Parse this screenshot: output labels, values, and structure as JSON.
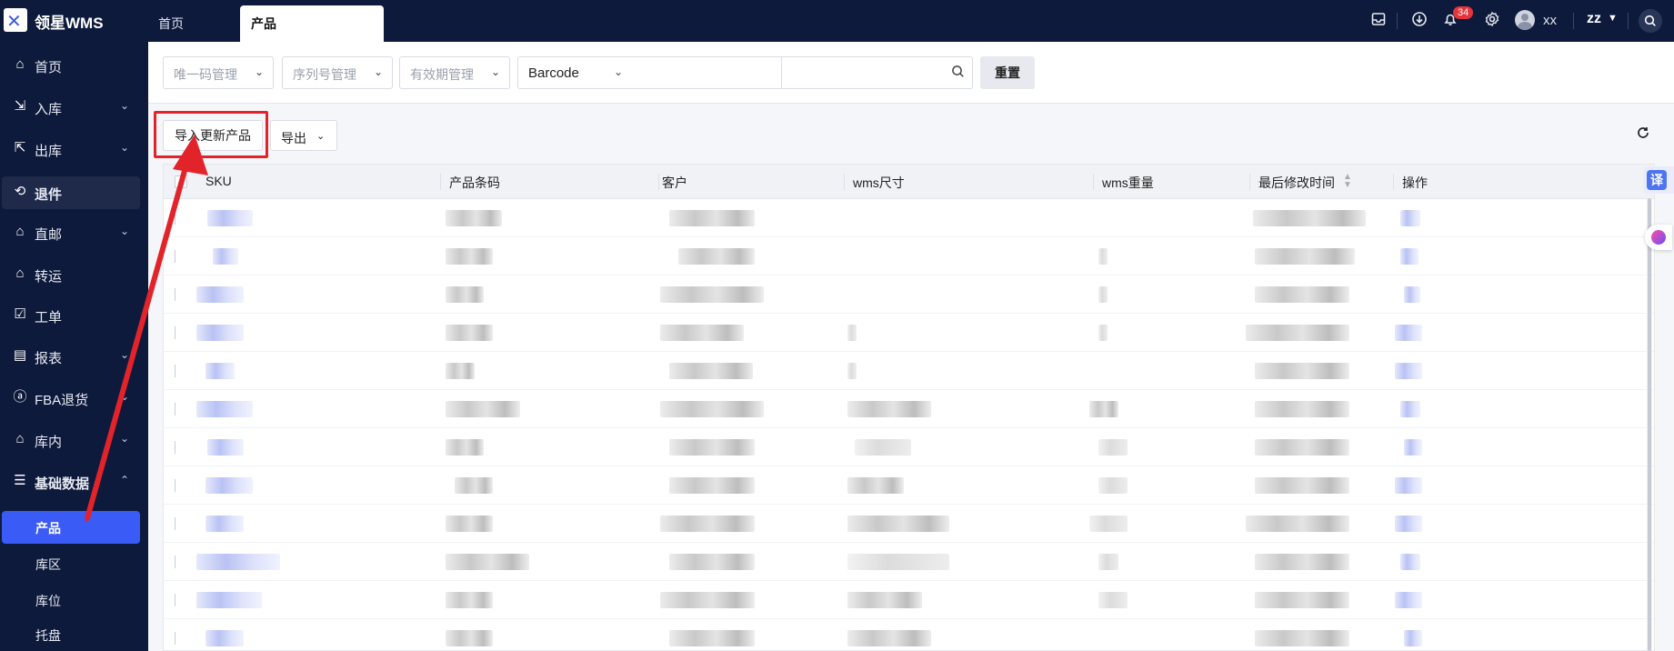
{
  "app": {
    "brand": "领星WMS"
  },
  "top_tabs": [
    {
      "label": "首页"
    },
    {
      "label": "产品"
    }
  ],
  "topbar": {
    "notification_count": "34",
    "user_name": "xx",
    "org_name": "zz"
  },
  "sidebar": {
    "items": [
      {
        "label": "首页"
      },
      {
        "label": "入库"
      },
      {
        "label": "出库"
      },
      {
        "label": "退件"
      },
      {
        "label": "直邮"
      },
      {
        "label": "转运"
      },
      {
        "label": "工单"
      },
      {
        "label": "报表"
      },
      {
        "label": "FBA退货"
      },
      {
        "label": "库内"
      },
      {
        "label": "基础数据"
      }
    ],
    "sub_items": [
      {
        "label": "产品"
      },
      {
        "label": "库区"
      },
      {
        "label": "库位"
      },
      {
        "label": "托盘"
      }
    ]
  },
  "filters": {
    "unique_code": "唯一码管理",
    "serial_no": "序列号管理",
    "expiry": "有效期管理",
    "search_field": "Barcode",
    "search_value": "",
    "reset": "重置"
  },
  "toolbar": {
    "import_label": "导入更新产品",
    "export_label": "导出"
  },
  "table": {
    "columns": [
      "SKU",
      "产品条码",
      "客户",
      "wms尺寸",
      "wms重量",
      "最后修改时间",
      "操作"
    ]
  },
  "floating": {
    "translate_label": "译"
  },
  "colors": {
    "nav_bg": "#0e1a3b",
    "active_item": "#3b5bf6",
    "highlight": "#e3232a"
  }
}
